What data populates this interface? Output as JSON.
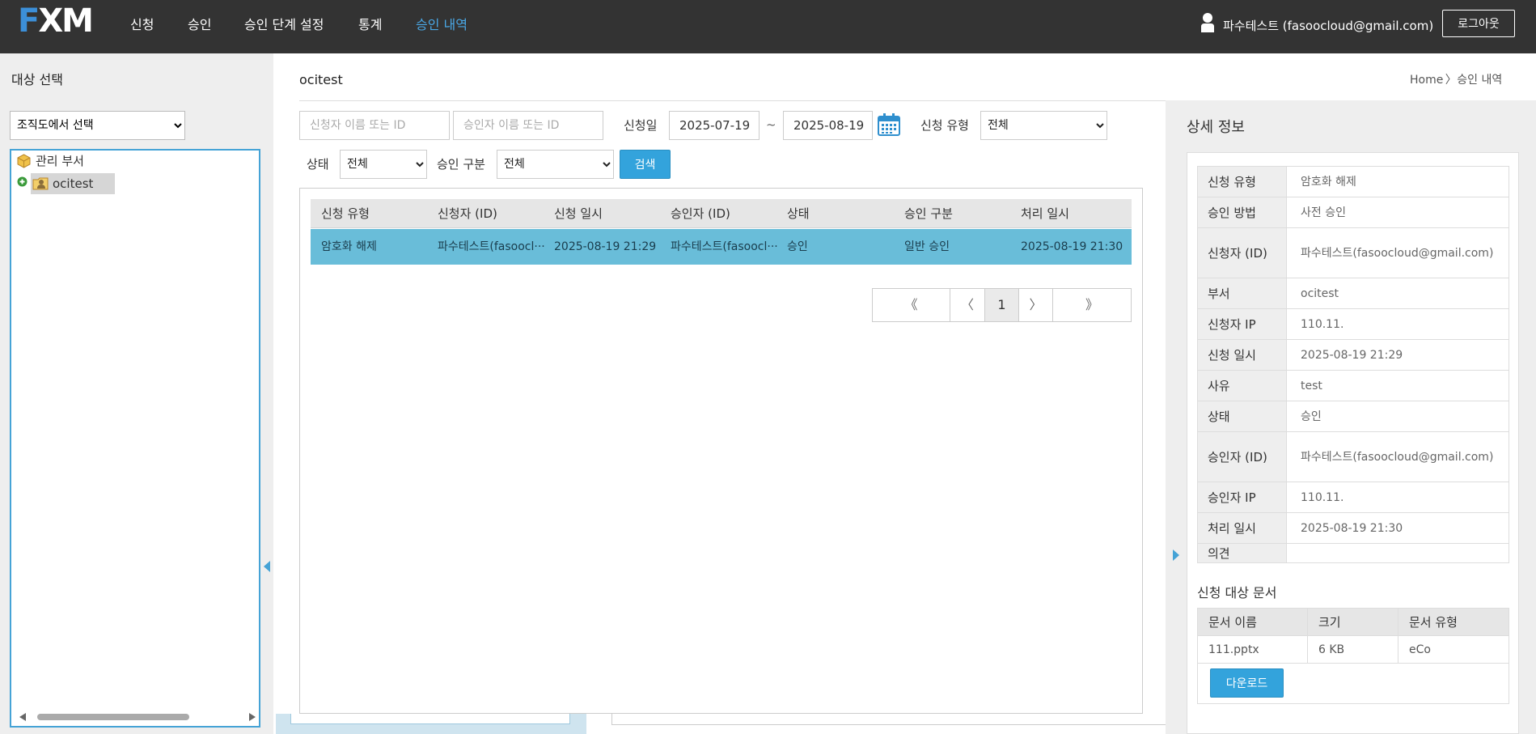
{
  "app": {
    "logo_f": "F",
    "logo_xm": "XM"
  },
  "nav": {
    "items": [
      {
        "label": "신청"
      },
      {
        "label": "승인"
      },
      {
        "label": "승인 단계 설정"
      },
      {
        "label": "통계"
      },
      {
        "label": "승인 내역",
        "active": true
      }
    ],
    "user": "파수테스트 (fasoocloud@gmail.com)",
    "logout": "로그아웃"
  },
  "left": {
    "title": "대상 선택",
    "select_value": "조직도에서 선택",
    "tree": [
      {
        "label": "관리 부서",
        "icon": "box-icon"
      },
      {
        "label": "ocitest",
        "icon": "user-folder-icon",
        "selected": true
      }
    ]
  },
  "main": {
    "org_name": "ocitest",
    "breadcrumb": {
      "home": "Home",
      "sep": "〉",
      "current": "승인 내역"
    },
    "filters": {
      "requester_placeholder": "신청자 이름 또는 ID",
      "approver_placeholder": "승인자 이름 또는 ID",
      "date_label": "신청일",
      "date_from": "2025-07-19",
      "date_sep": "~",
      "date_to": "2025-08-19",
      "type_label": "신청 유형",
      "type_value": "전체",
      "status_label": "상태",
      "status_value": "전체",
      "approval_kind_label": "승인 구분",
      "approval_kind_value": "전체",
      "search_button": "검색"
    },
    "table": {
      "columns": [
        "신청 유형",
        "신청자 (ID)",
        "신청 일시",
        "승인자 (ID)",
        "상태",
        "승인 구분",
        "처리 일시"
      ],
      "rows": [
        [
          "암호화 해제",
          "파수테스트(fasoocl···",
          "2025-08-19 21:29",
          "파수테스트(fasoocl···",
          "승인",
          "일반 승인",
          "2025-08-19 21:30"
        ]
      ]
    },
    "pager": {
      "first": "《",
      "prev": "〈",
      "current": "1",
      "next": "〉",
      "last": "》"
    }
  },
  "detail": {
    "title": "상세 정보",
    "fields": [
      {
        "key": "신청 유형",
        "value": "암호화 해제"
      },
      {
        "key": "승인 방법",
        "value": "사전 승인"
      },
      {
        "key": "신청자 (ID)",
        "value": "파수테스트(fasoocloud@gmail.com)"
      },
      {
        "key": "부서",
        "value": "ocitest"
      },
      {
        "key": "신청자 IP",
        "value": "110.11."
      },
      {
        "key": "신청 일시",
        "value": "2025-08-19 21:29"
      },
      {
        "key": "사유",
        "value": "test"
      },
      {
        "key": "상태",
        "value": "승인"
      },
      {
        "key": "승인자 (ID)",
        "value": "파수테스트(fasoocloud@gmail.com)"
      },
      {
        "key": "승인자 IP",
        "value": "110.11."
      },
      {
        "key": "처리 일시",
        "value": "2025-08-19 21:30"
      },
      {
        "key": "의견",
        "value": ""
      }
    ],
    "docs_title": "신청 대상 문서",
    "docs_columns": [
      "문서 이름",
      "크기",
      "문서 유형"
    ],
    "docs_rows": [
      [
        "111.pptx",
        "6 KB",
        "eCo"
      ]
    ],
    "download_button": "다운로드"
  },
  "colors": {
    "topbar": "#333333",
    "accent": "#33a3dc",
    "selected_row": "#69bdd9",
    "active_nav": "#4aa8e6"
  }
}
